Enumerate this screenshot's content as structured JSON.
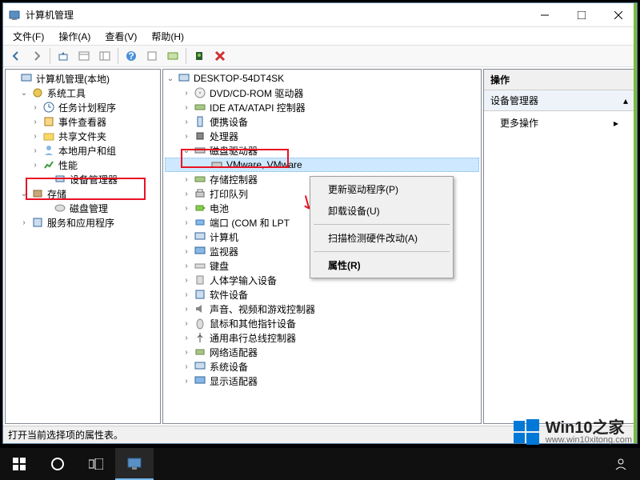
{
  "window": {
    "title": "计算机管理"
  },
  "menubar": {
    "file": "文件(F)",
    "action": "操作(A)",
    "view": "查看(V)",
    "help": "帮助(H)"
  },
  "left_tree": {
    "root": "计算机管理(本地)",
    "system_tools": "系统工具",
    "task_scheduler": "任务计划程序",
    "event_viewer": "事件查看器",
    "shared_folders": "共享文件夹",
    "local_users": "本地用户和组",
    "performance": "性能",
    "device_manager": "设备管理器",
    "storage": "存储",
    "disk_management": "磁盘管理",
    "services": "服务和应用程序"
  },
  "mid_tree": {
    "computer": "DESKTOP-54DT4SK",
    "dvd": "DVD/CD-ROM 驱动器",
    "ide": "IDE ATA/ATAPI 控制器",
    "portable": "便携设备",
    "processor": "处理器",
    "disk_drives": "磁盘驱动器",
    "disk_item": "VMware, VMware",
    "storage_ctrl": "存储控制器",
    "print_queue": "打印队列",
    "battery": "电池",
    "ports": "端口 (COM 和 LPT",
    "computers": "计算机",
    "monitors": "监视器",
    "keyboards": "键盘",
    "hid": "人体学输入设备",
    "software": "软件设备",
    "sound": "声音、视频和游戏控制器",
    "mouse": "鼠标和其他指针设备",
    "usb": "通用串行总线控制器",
    "network": "网络适配器",
    "system_dev": "系统设备",
    "display": "显示适配器"
  },
  "context_menu": {
    "update": "更新驱动程序(P)",
    "uninstall": "卸载设备(U)",
    "scan": "扫描检测硬件改动(A)",
    "properties": "属性(R)"
  },
  "right_panel": {
    "header": "操作",
    "device_mgr": "设备管理器",
    "more": "更多操作"
  },
  "statusbar": {
    "text": "打开当前选择项的属性表。"
  },
  "watermark": {
    "text": "Win10之家",
    "url": "www.win10xitong.com"
  }
}
